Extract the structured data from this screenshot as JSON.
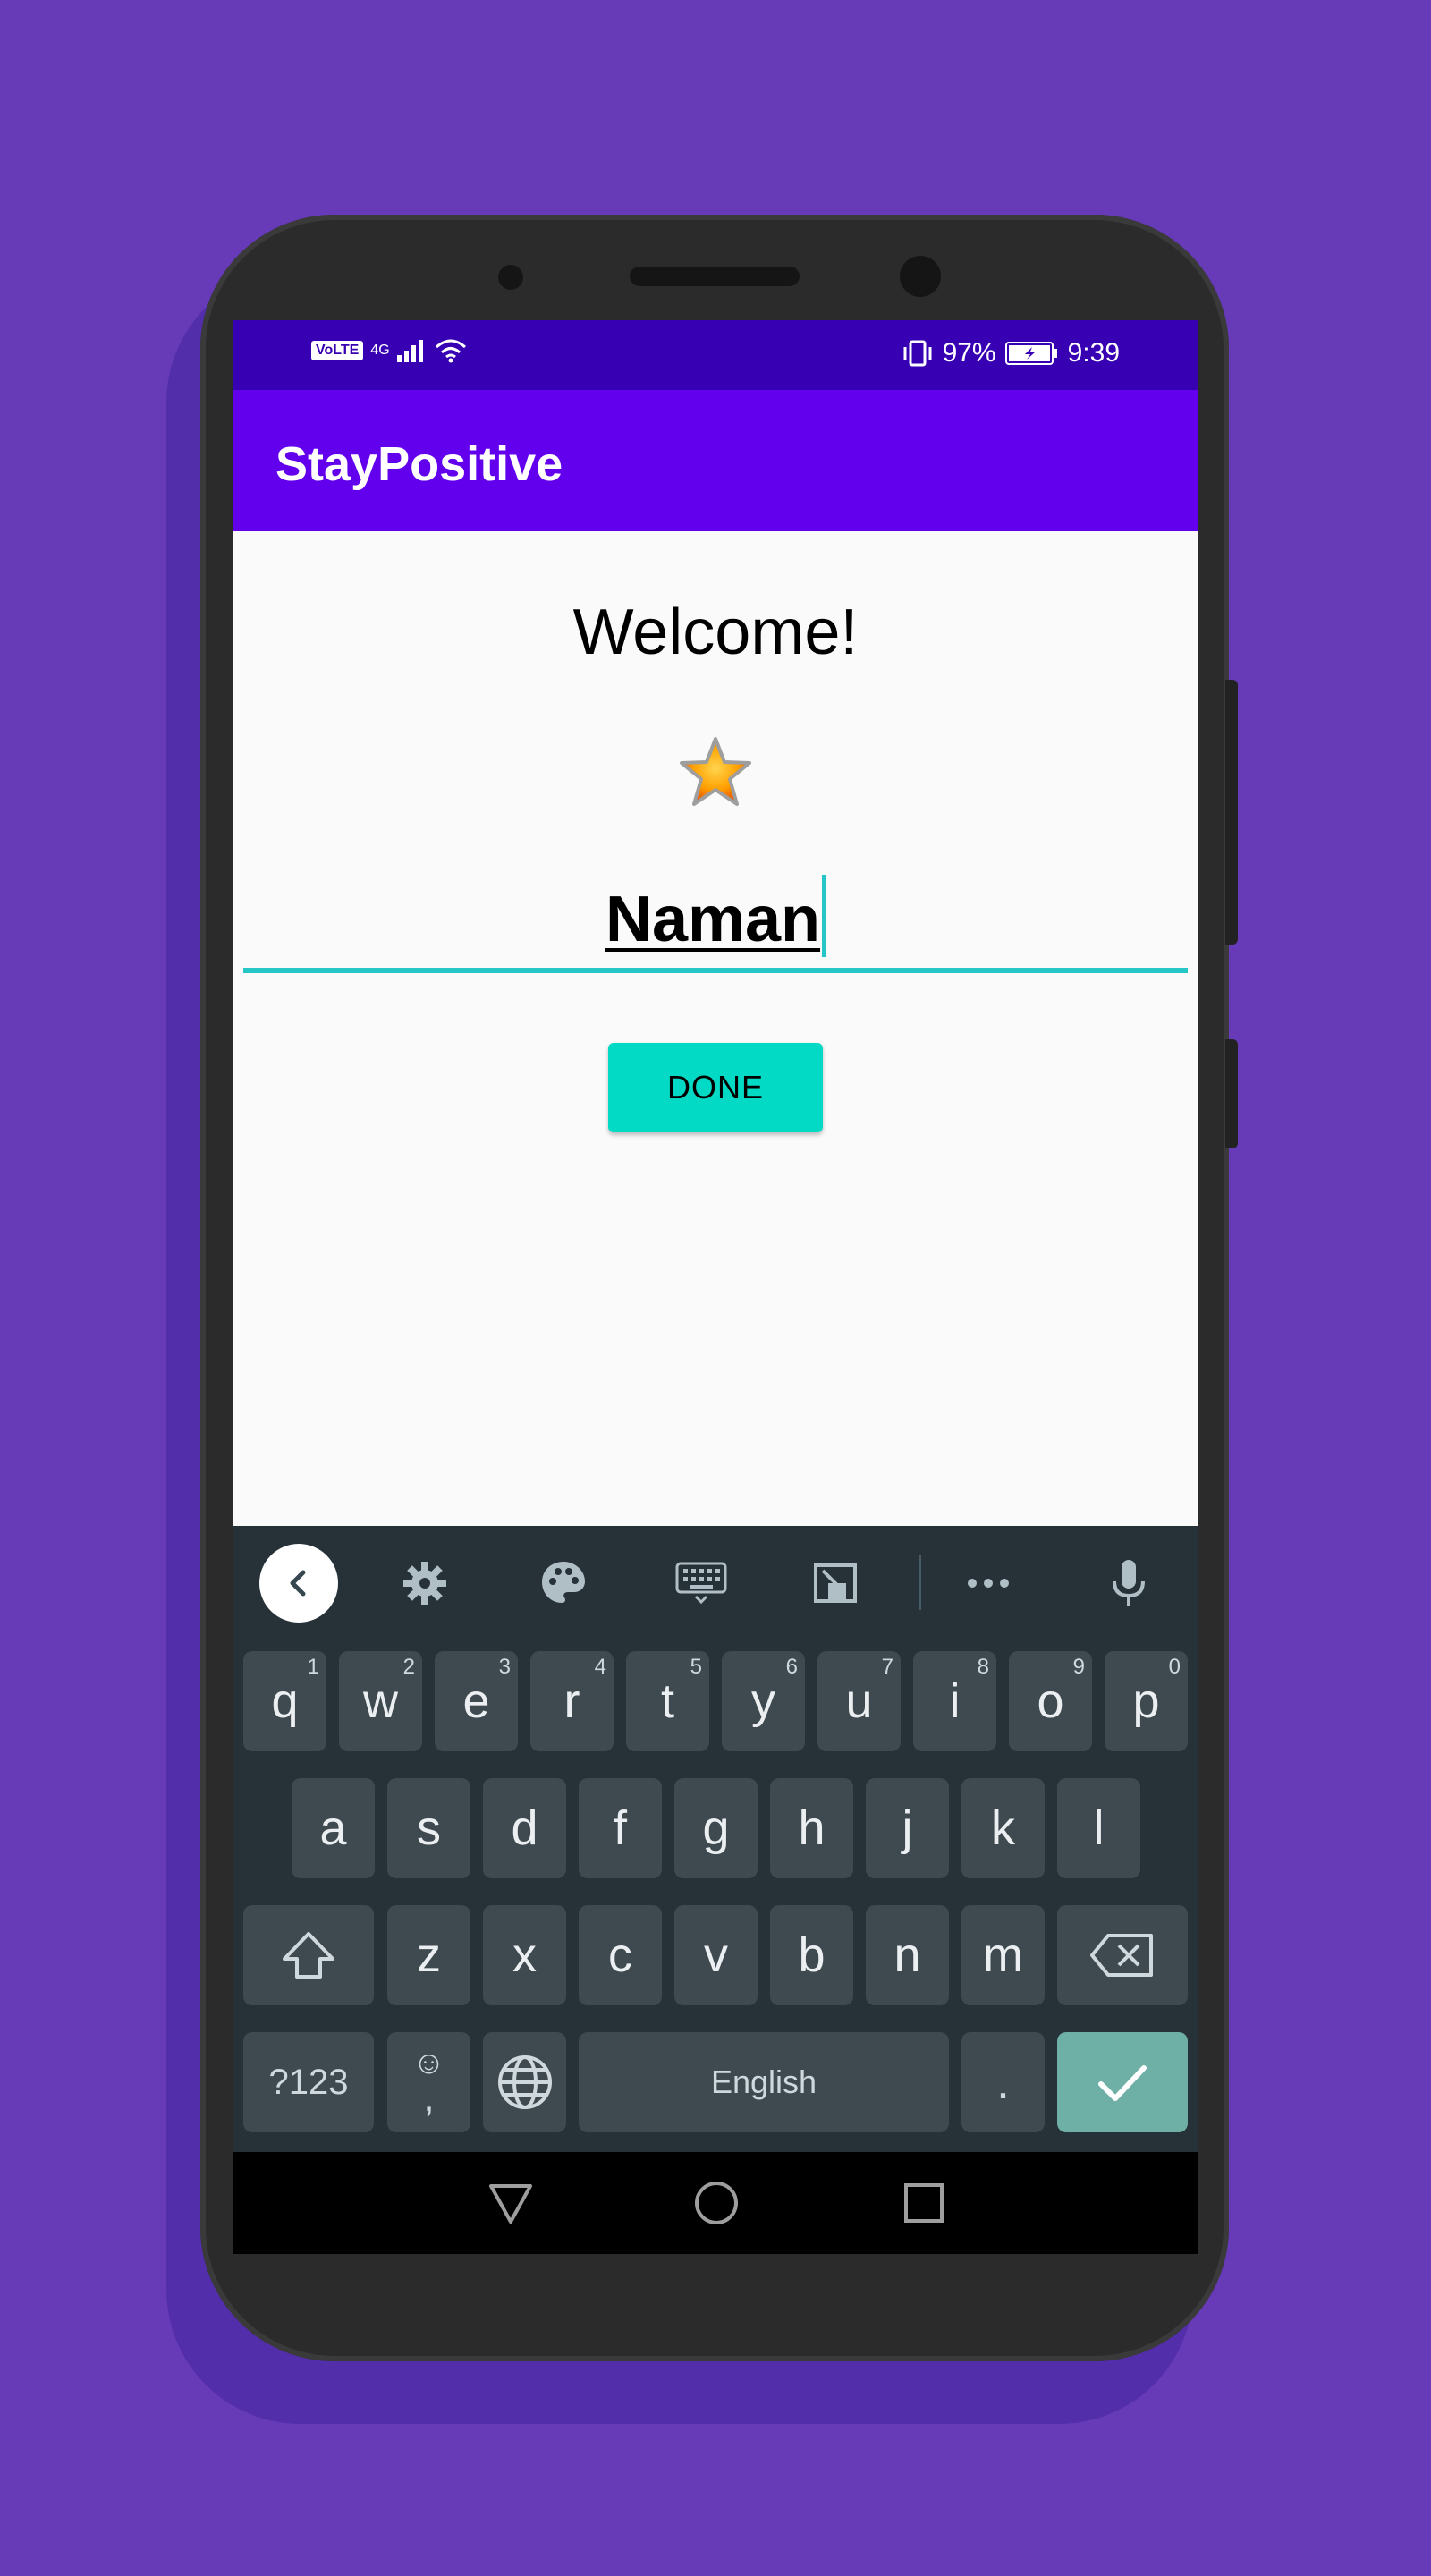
{
  "app": {
    "title": "StayPositive",
    "accent_color": "#6200EE",
    "status_bar_color": "#3700B3",
    "button_color": "#03DAC5"
  },
  "status_bar": {
    "left": {
      "volte": "VoLTE",
      "network": "4G"
    },
    "battery_percent": "97%",
    "time": "9:39"
  },
  "main": {
    "welcome_text": "Welcome!",
    "star_icon": "star-icon",
    "name_value": "Naman",
    "done_label": "DONE"
  },
  "keyboard": {
    "toolbar_icons": [
      "back-chevron-icon",
      "settings-gear-icon",
      "palette-icon",
      "keyboard-icon",
      "one-handed-icon",
      "more-icon",
      "microphone-icon"
    ],
    "row1": [
      {
        "key": "q",
        "hint": "1"
      },
      {
        "key": "w",
        "hint": "2"
      },
      {
        "key": "e",
        "hint": "3"
      },
      {
        "key": "r",
        "hint": "4"
      },
      {
        "key": "t",
        "hint": "5"
      },
      {
        "key": "y",
        "hint": "6"
      },
      {
        "key": "u",
        "hint": "7"
      },
      {
        "key": "i",
        "hint": "8"
      },
      {
        "key": "o",
        "hint": "9"
      },
      {
        "key": "p",
        "hint": "0"
      }
    ],
    "row2": [
      "a",
      "s",
      "d",
      "f",
      "g",
      "h",
      "j",
      "k",
      "l"
    ],
    "row3": [
      "z",
      "x",
      "c",
      "v",
      "b",
      "n",
      "m"
    ],
    "symbols_label": "?123",
    "emoji_comma": {
      "top": "☺",
      "bottom": ","
    },
    "space_label": "English",
    "period_label": "."
  }
}
